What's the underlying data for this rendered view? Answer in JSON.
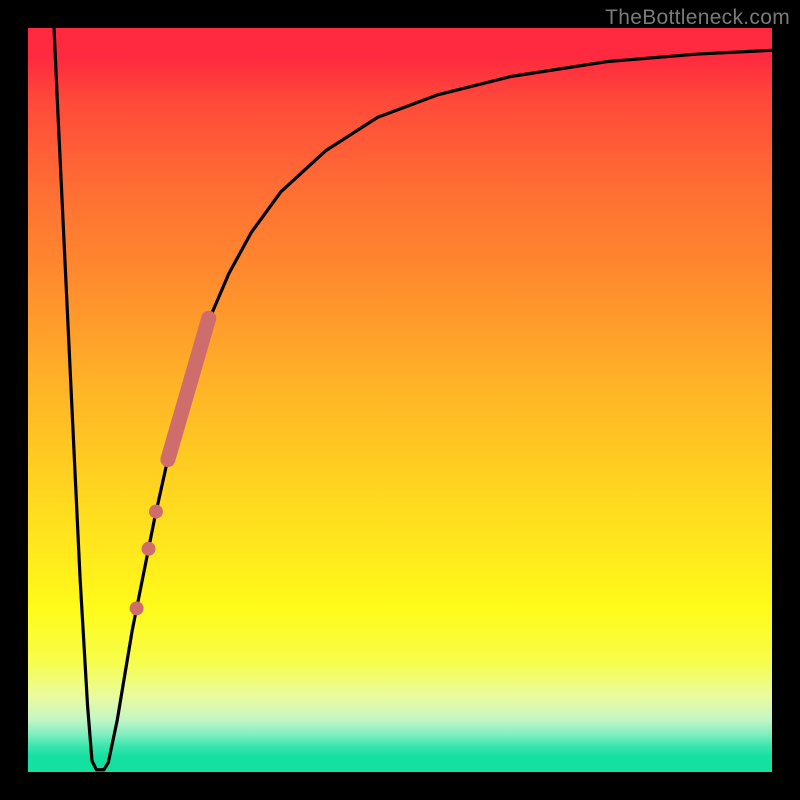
{
  "watermark": "TheBottleneck.com",
  "chart_data": {
    "type": "line",
    "title": "",
    "xlabel": "",
    "ylabel": "",
    "xlim": [
      0,
      100
    ],
    "ylim": [
      0,
      100
    ],
    "grid": false,
    "legend": false,
    "curve": [
      {
        "x": 3.5,
        "y": 100.0
      },
      {
        "x": 4.0,
        "y": 89.0
      },
      {
        "x": 5.0,
        "y": 68.0
      },
      {
        "x": 6.0,
        "y": 47.0
      },
      {
        "x": 7.0,
        "y": 26.0
      },
      {
        "x": 8.0,
        "y": 9.0
      },
      {
        "x": 8.6,
        "y": 1.5
      },
      {
        "x": 9.2,
        "y": 0.3
      },
      {
        "x": 10.2,
        "y": 0.3
      },
      {
        "x": 10.8,
        "y": 1.3
      },
      {
        "x": 12.0,
        "y": 7.0
      },
      {
        "x": 13.0,
        "y": 13.0
      },
      {
        "x": 14.0,
        "y": 19.0
      },
      {
        "x": 15.0,
        "y": 24.0
      },
      {
        "x": 17.0,
        "y": 34.0
      },
      {
        "x": 19.0,
        "y": 43.0
      },
      {
        "x": 21.0,
        "y": 51.0
      },
      {
        "x": 24.0,
        "y": 60.0
      },
      {
        "x": 27.0,
        "y": 67.0
      },
      {
        "x": 30.0,
        "y": 72.5
      },
      {
        "x": 34.0,
        "y": 78.0
      },
      {
        "x": 40.0,
        "y": 83.5
      },
      {
        "x": 47.0,
        "y": 88.0
      },
      {
        "x": 55.0,
        "y": 91.0
      },
      {
        "x": 65.0,
        "y": 93.5
      },
      {
        "x": 78.0,
        "y": 95.5
      },
      {
        "x": 90.0,
        "y": 96.5
      },
      {
        "x": 100.0,
        "y": 97.0
      }
    ],
    "thick_segment": {
      "start": {
        "x": 18.8,
        "y": 42.0
      },
      "end": {
        "x": 24.3,
        "y": 61.0
      }
    },
    "dots": [
      {
        "x": 17.2,
        "y": 35.0
      },
      {
        "x": 16.2,
        "y": 30.0
      },
      {
        "x": 14.6,
        "y": 22.0
      }
    ],
    "curve_color": "#000000",
    "accent_color": "#cf6d6c"
  }
}
